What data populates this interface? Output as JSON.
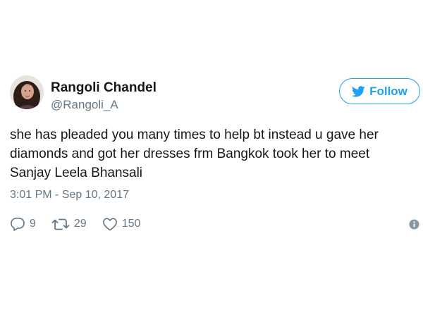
{
  "author": {
    "name": "Rangoli Chandel",
    "handle": "@Rangoli_A"
  },
  "follow_button": {
    "label": "Follow",
    "icon": "twitter-bird-icon"
  },
  "tweet": {
    "lines": [
      "she has pleaded you many times to help bt instead u gave her",
      "diamonds and got her dresses frm Bangkok took her to meet",
      "Sanjay Leela Bhansali"
    ],
    "timestamp": "3:01 PM - Sep 10, 2017"
  },
  "actions": {
    "replies": "9",
    "retweets": "29",
    "likes": "150"
  },
  "colors": {
    "brand_blue": "#1da1f2",
    "muted_gray": "#657786",
    "text": "#14171a"
  },
  "icons": {
    "reply": "reply-icon",
    "retweet": "retweet-icon",
    "like": "heart-icon",
    "info": "info-icon"
  }
}
